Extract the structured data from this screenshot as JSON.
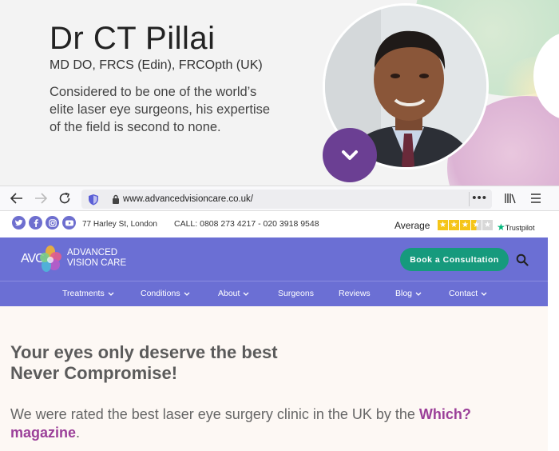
{
  "hero": {
    "name": "Dr CT Pillai",
    "qualifications": "MD DO, FRCS (Edin), FRCOpth (UK)",
    "description": "Considered to be one of the world’s elite laser eye surgeons, his expertise of the field is second to none."
  },
  "browser": {
    "url": "www.advancedvisioncare.co.uk/",
    "more": "•••"
  },
  "topbar": {
    "social": [
      "twitter-icon",
      "facebook-icon",
      "instagram-icon",
      "youtube-icon"
    ],
    "address": "77 Harley St, London",
    "phone": "CALL: 0808 273 4217 - 020 3918 9548",
    "rating_label": "Average",
    "rating_stars": 3.5,
    "rating_max": 5,
    "trustpilot": "Trustpilot"
  },
  "header": {
    "logo_mark": "AVC",
    "logo_line1": "ADVANCED",
    "logo_line2": "VISION CARE",
    "cta": "Book a Consultation",
    "menu": [
      {
        "label": "Treatments",
        "dropdown": true
      },
      {
        "label": "Conditions",
        "dropdown": true
      },
      {
        "label": "About",
        "dropdown": true
      },
      {
        "label": "Surgeons",
        "dropdown": false
      },
      {
        "label": "Reviews",
        "dropdown": false
      },
      {
        "label": "Blog",
        "dropdown": true
      },
      {
        "label": "Contact",
        "dropdown": true
      }
    ]
  },
  "content": {
    "headline_line1": "Your eyes only deserve the best",
    "headline_line2": "Never Compromise!",
    "para_before": "We were rated the best laser eye surgery clinic in the UK by the ",
    "para_link": "Which? magazine",
    "para_after": "."
  },
  "colors": {
    "brand_purple": "#6b6fd4",
    "cta_green": "#169a7d",
    "link_magenta": "#9b3f99",
    "hero_button": "#6b3f93"
  }
}
